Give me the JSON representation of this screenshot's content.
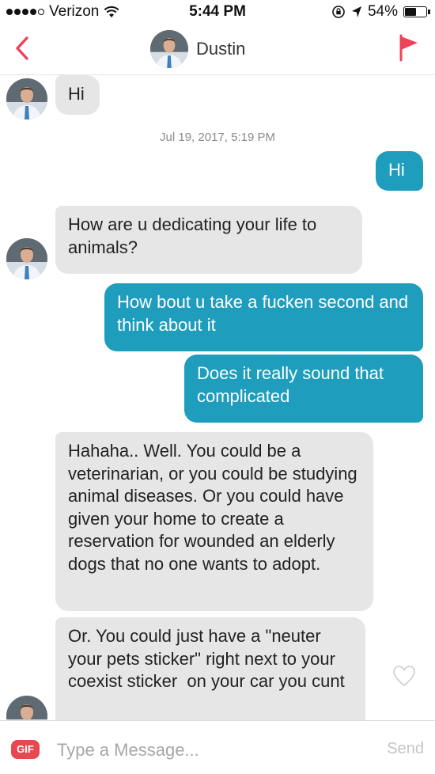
{
  "status_bar": {
    "carrier": "Verizon",
    "time": "5:44 PM",
    "battery": "54%",
    "battery_level": 0.54
  },
  "header": {
    "contact_name": "Dustin",
    "back_icon": "chevron-left-icon",
    "report_icon": "flag-icon",
    "accent_color": "#f0415a"
  },
  "conversation": {
    "timestamp": "Jul 19, 2017, 5:19 PM",
    "messages": [
      {
        "from": "them",
        "text": "Hi"
      },
      {
        "from": "me",
        "text": "Hi"
      },
      {
        "from": "them",
        "text": "How are u dedicating your life to animals?"
      },
      {
        "from": "me",
        "text": "How bout u take a fucken second and think about it"
      },
      {
        "from": "me",
        "text": "Does it really sound that complicated"
      },
      {
        "from": "them",
        "text": "Hahaha.. Well. You could be a veterinarian, or you could be studying animal diseases. Or you could have given your home to create a reservation for wounded an elderly dogs that no one wants to adopt."
      },
      {
        "from": "them",
        "text": "Or. You could just have a \"neuter your pets sticker\" right next to your coexist sticker  on your car you cunt"
      }
    ],
    "incoming_color": "#e6e6e6",
    "outgoing_color": "#1e9dbd"
  },
  "composer": {
    "gif_label": "GIF",
    "placeholder": "Type a Message...",
    "send_label": "Send"
  }
}
